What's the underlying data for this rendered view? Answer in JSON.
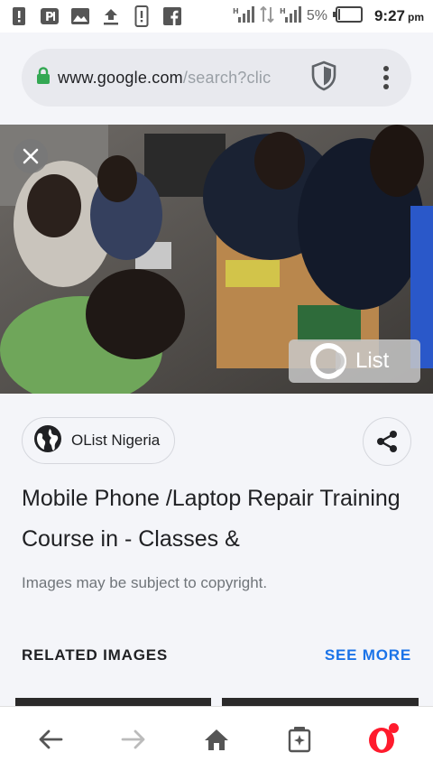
{
  "status_bar": {
    "icons_left": [
      "notification-alert-icon",
      "parking-app-icon",
      "gallery-icon",
      "upload-icon",
      "phone-alert-icon",
      "facebook-icon"
    ],
    "battery_percent": "5%",
    "time": "9:27",
    "ampm": "pm"
  },
  "address_bar": {
    "url_host": "www.google.com",
    "url_path": "/search?clic",
    "secure": true
  },
  "image_viewer": {
    "badge_text": "List"
  },
  "source": {
    "name": "OList Nigeria"
  },
  "result": {
    "title": "Mobile Phone /Laptop Repair Training Course in - Classes &",
    "copyright_notice": "Images may be subject to copyright."
  },
  "related": {
    "heading": "RELATED IMAGES",
    "see_more_label": "SEE MORE"
  },
  "bottom_nav": {
    "items": [
      "back-icon",
      "forward-icon",
      "home-icon",
      "tabs-icon",
      "opera-menu-icon"
    ]
  },
  "colors": {
    "accent_blue": "#1a73e8",
    "opera_red": "#ff1b2d",
    "secure_green": "#34a853"
  }
}
